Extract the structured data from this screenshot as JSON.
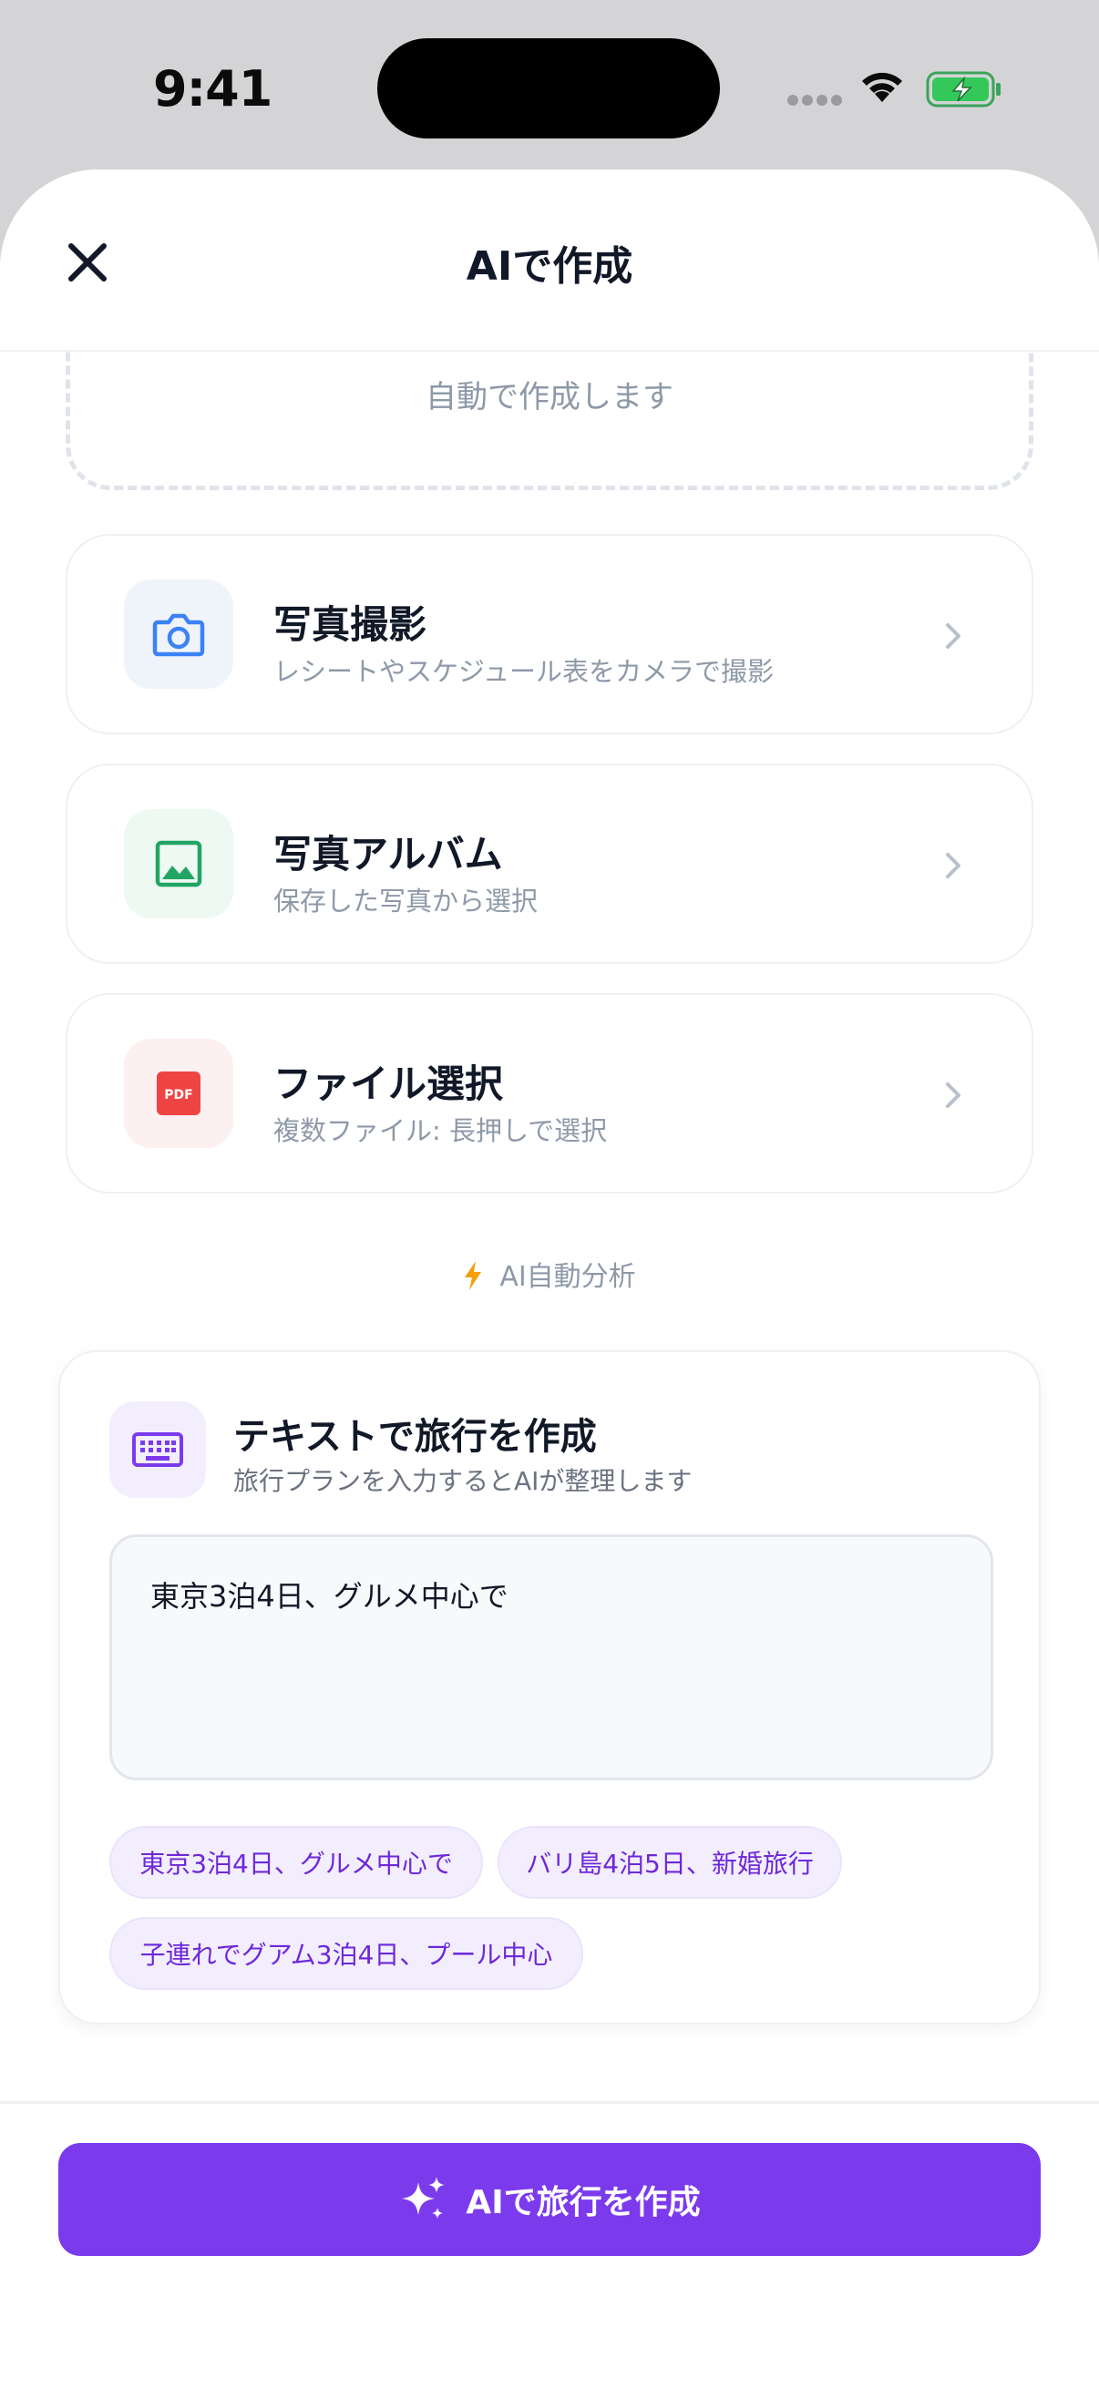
{
  "status_bar": {
    "time": "9:41"
  },
  "header": {
    "title": "AIで作成",
    "close_icon": "close-icon"
  },
  "dropzone": {
    "text": "自動で作成します"
  },
  "options": [
    {
      "title": "写真撮影",
      "subtitle": "レシートやスケジュール表をカメラで撮影",
      "icon": "camera-icon"
    },
    {
      "title": "写真アルバム",
      "subtitle": "保存した写真から選択",
      "icon": "image-icon"
    },
    {
      "title": "ファイル選択",
      "subtitle": "複数ファイル: 長押しで選択",
      "icon": "pdf-icon"
    }
  ],
  "ai_auto": {
    "label": "AI自動分析",
    "icon": "lightning-icon"
  },
  "text_create": {
    "title": "テキストで旅行を作成",
    "subtitle": "旅行プランを入力するとAIが整理します",
    "input_value": "東京3泊4日、グルメ中心で",
    "chips": [
      "東京3泊4日、グルメ中心で",
      "バリ島4泊5日、新婚旅行",
      "子連れでグアム3泊4日、プール中心"
    ]
  },
  "footer": {
    "button_label": "AIで旅行を作成",
    "icon": "sparkles-icon"
  },
  "colors": {
    "accent": "#7c3aed",
    "camera": "#3b82f6",
    "album": "#22a564",
    "pdf": "#ef4444",
    "bolt": "#f59e0b"
  }
}
